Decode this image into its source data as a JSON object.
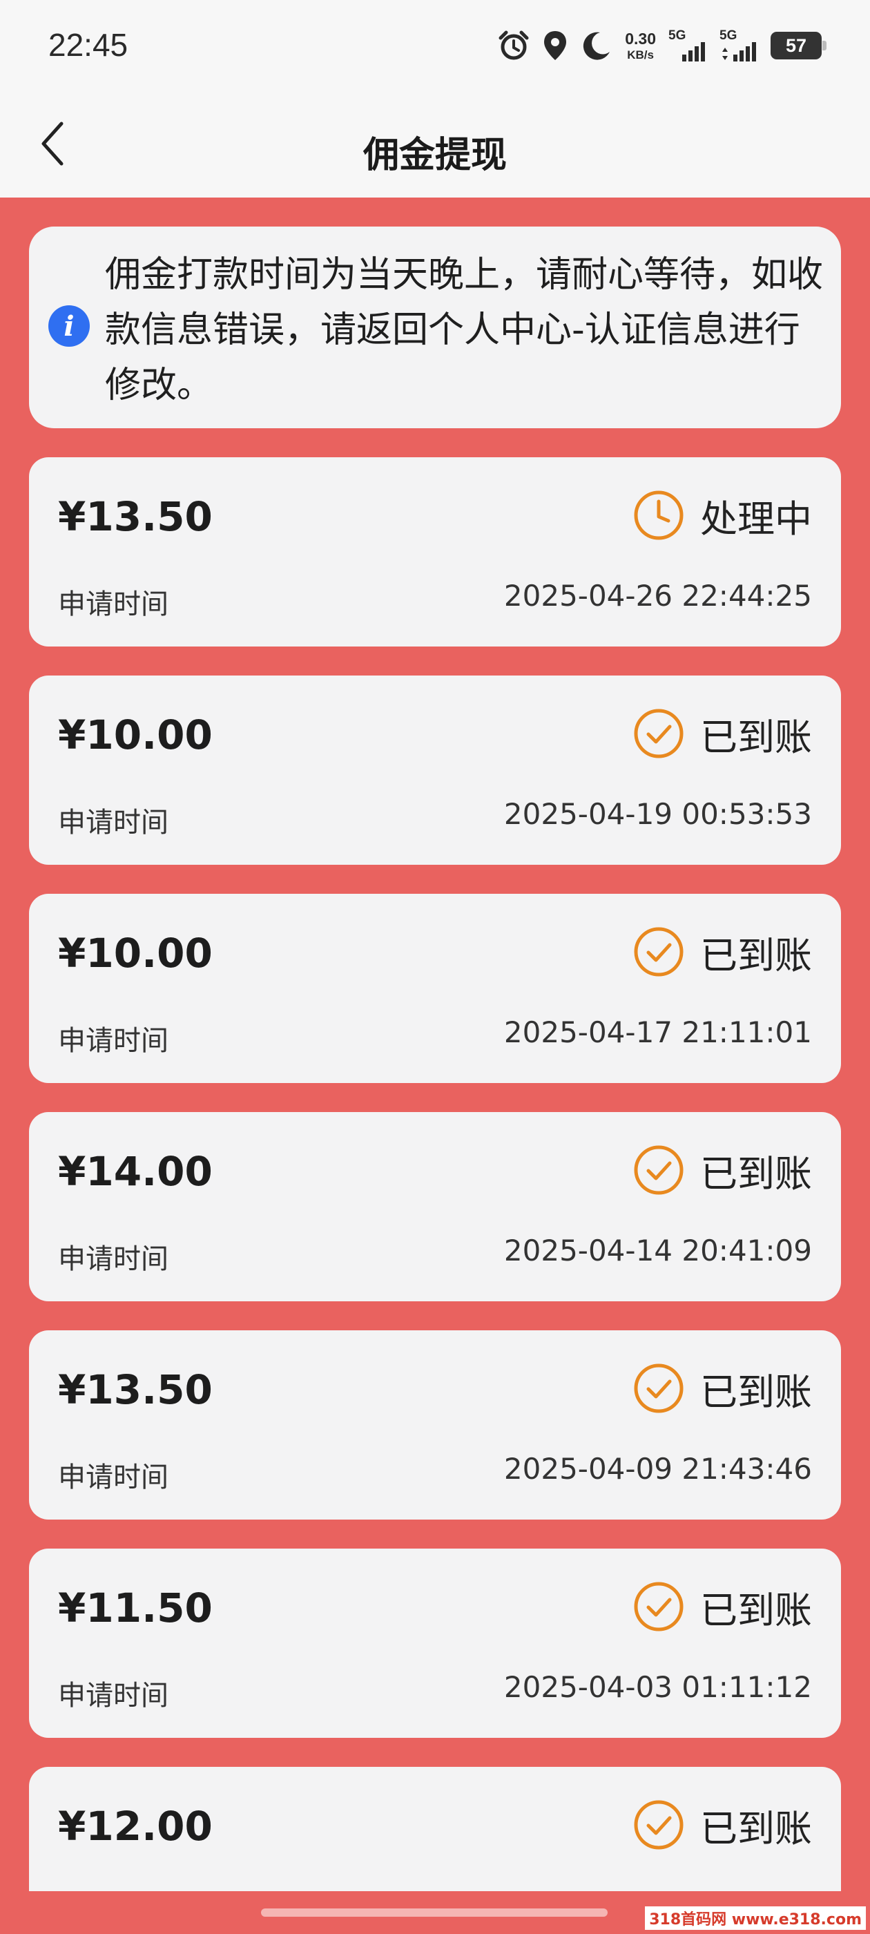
{
  "status_bar": {
    "time": "22:45",
    "net_speed": "0.30",
    "net_unit": "KB/s",
    "sim1": "5G",
    "sim2": "5G",
    "battery": "57",
    "icons": [
      "alarm-icon",
      "location-icon",
      "moon-icon",
      "signal-icon",
      "signal-icon",
      "battery-icon"
    ]
  },
  "header": {
    "title": "佣金提现",
    "back_icon": "chevron-left-icon"
  },
  "notice": {
    "icon": "info-icon",
    "text": "佣金打款时间为当天晚上，请耐心等待，如收款信息错误，请返回个人中心-认证信息进行修改。"
  },
  "records": [
    {
      "amount": "¥13.50",
      "status": "处理中",
      "status_icon": "clock-icon",
      "label": "申请时间",
      "time": "2025-04-26 22:44:25"
    },
    {
      "amount": "¥10.00",
      "status": "已到账",
      "status_icon": "check-circle-icon",
      "label": "申请时间",
      "time": "2025-04-19 00:53:53"
    },
    {
      "amount": "¥10.00",
      "status": "已到账",
      "status_icon": "check-circle-icon",
      "label": "申请时间",
      "time": "2025-04-17 21:11:01"
    },
    {
      "amount": "¥14.00",
      "status": "已到账",
      "status_icon": "check-circle-icon",
      "label": "申请时间",
      "time": "2025-04-14 20:41:09"
    },
    {
      "amount": "¥13.50",
      "status": "已到账",
      "status_icon": "check-circle-icon",
      "label": "申请时间",
      "time": "2025-04-09 21:43:46"
    },
    {
      "amount": "¥11.50",
      "status": "已到账",
      "status_icon": "check-circle-icon",
      "label": "申请时间",
      "time": "2025-04-03 01:11:12"
    },
    {
      "amount": "¥12.00",
      "status": "已到账",
      "status_icon": "check-circle-icon"
    }
  ],
  "watermark": "318首码网 www.e318.com",
  "colors": {
    "background": "#e9625f",
    "card": "#f3f3f4",
    "status_orange": "#e8891f",
    "info_blue": "#2f6ff1"
  }
}
